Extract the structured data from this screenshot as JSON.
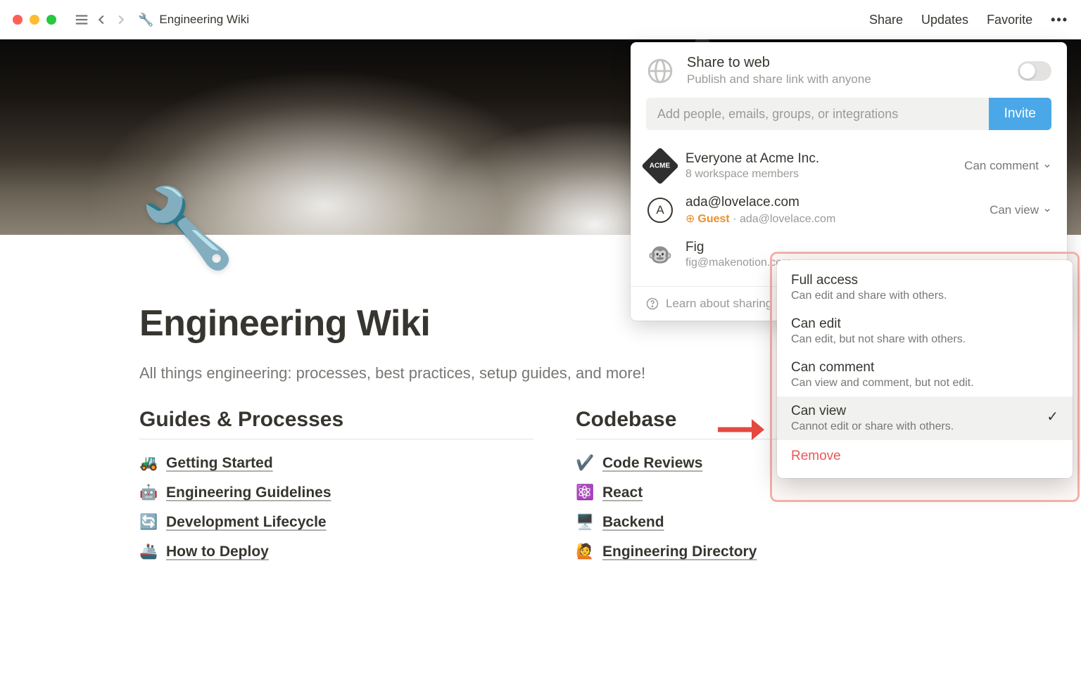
{
  "topbar": {
    "breadcrumb_icon": "🔧",
    "breadcrumb": "Engineering Wiki",
    "share": "Share",
    "updates": "Updates",
    "favorite": "Favorite"
  },
  "page": {
    "icon": "🔧",
    "title": "Engineering Wiki",
    "subtitle": "All things engineering: processes, best practices, setup guides, and more!",
    "col1_heading": "Guides & Processes",
    "col2_heading": "Codebase",
    "col1_links": [
      {
        "emoji": "🚜",
        "label": "Getting Started"
      },
      {
        "emoji": "🤖",
        "label": "Engineering Guidelines"
      },
      {
        "emoji": "🔄",
        "label": "Development Lifecycle"
      },
      {
        "emoji": "🚢",
        "label": "How to Deploy"
      }
    ],
    "col2_links": [
      {
        "emoji": "✔️",
        "label": "Code Reviews"
      },
      {
        "emoji": "⚛️",
        "label": "React"
      },
      {
        "emoji": "🖥️",
        "label": "Backend"
      },
      {
        "emoji": "🙋",
        "label": "Engineering Directory"
      }
    ]
  },
  "share_panel": {
    "stw_title": "Share to web",
    "stw_sub": "Publish and share link with anyone",
    "invite_placeholder": "Add people, emails, groups, or integrations",
    "invite_btn": "Invite",
    "footer": "Learn about sharing",
    "items": [
      {
        "name": "Everyone at Acme Inc.",
        "sub": "8 workspace members",
        "perm": "Can comment",
        "icon_text": "ACME"
      },
      {
        "name": "ada@lovelace.com",
        "guest": "Guest",
        "sub_email": "ada@lovelace.com",
        "perm": "Can view",
        "avatar": "A"
      },
      {
        "name": "Fig",
        "sub": "fig@makenotion.com",
        "perm": "",
        "fig": "🐵"
      }
    ]
  },
  "perm_menu": {
    "options": [
      {
        "title": "Full access",
        "desc": "Can edit and share with others."
      },
      {
        "title": "Can edit",
        "desc": "Can edit, but not share with others."
      },
      {
        "title": "Can comment",
        "desc": "Can view and comment, but not edit."
      },
      {
        "title": "Can view",
        "desc": "Cannot edit or share with others.",
        "selected": true
      }
    ],
    "remove": "Remove"
  }
}
